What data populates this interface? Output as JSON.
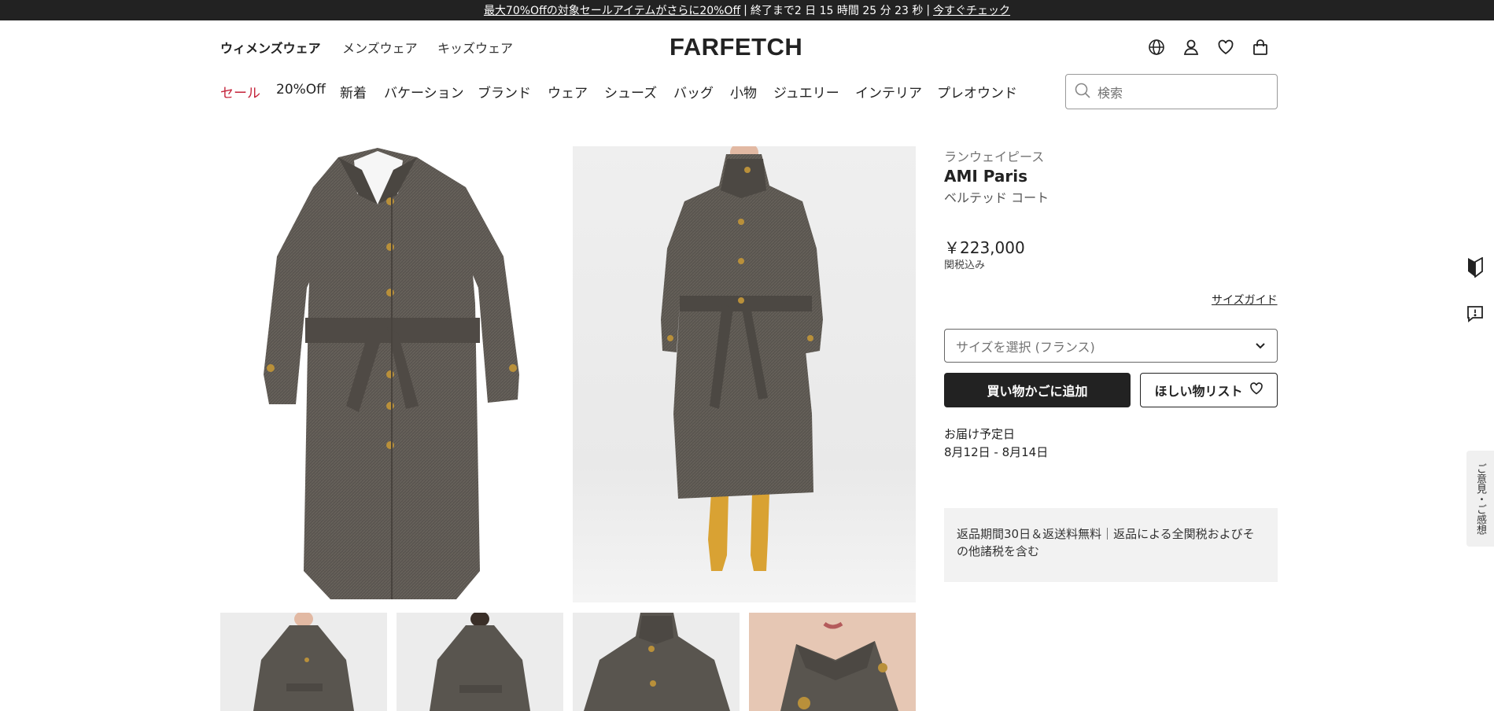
{
  "banner": {
    "promo_link": "最大70%Offの対象セールアイテムがさらに20%Off",
    "sep1": "|",
    "countdown": "終了まで2 日 15 時間 25 分 23 秒",
    "sep2": "|",
    "cta": "今すぐチェック"
  },
  "header": {
    "genders": [
      "ウィメンズウェア",
      "メンズウェア",
      "キッズウェア"
    ],
    "logo": "FARFETCH",
    "icons": [
      "globe-icon",
      "account-icon",
      "heart-icon",
      "bag-icon"
    ]
  },
  "categories": [
    "セール",
    "20%Off",
    "新着",
    "バケーション",
    "ブランド",
    "ウェア",
    "シューズ",
    "バッグ",
    "小物",
    "ジュエリー",
    "インテリア",
    "プレオウンド"
  ],
  "search": {
    "placeholder": "検索"
  },
  "product": {
    "label": "ランウェイピース",
    "brand": "AMI Paris",
    "name": "ベルテッド コート",
    "price": "￥223,000",
    "tax_note": "関税込み",
    "size_guide": "サイズガイド",
    "size_placeholder": "サイズを選択 (フランス)",
    "add_to_bag": "買い物かごに追加",
    "wishlist": "ほしい物リスト",
    "delivery_label": "お届け予定日",
    "delivery_dates": "8月12日 - 8月14日",
    "returns_text": "返品期間30日＆返送料無料｜返品による全関税およびその他諸税を含む"
  },
  "sidebar": {
    "feedback": "ご意見・ご感想"
  },
  "colors": {
    "sale": "#c4233a",
    "banner_bg": "#222222",
    "coat": "#5a5550",
    "boots": "#d9a233"
  }
}
